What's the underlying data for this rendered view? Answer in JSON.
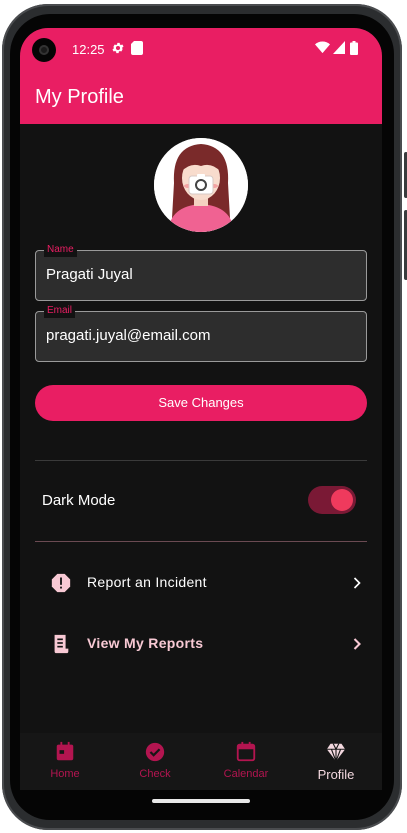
{
  "statusbar": {
    "time": "12:25",
    "icons": [
      "settings-icon",
      "sim-card-icon",
      "wifi-icon",
      "signal-icon",
      "battery-icon"
    ]
  },
  "appbar": {
    "title": "My Profile"
  },
  "profile": {
    "name_label": "Name",
    "name_value": "Pragati Juyal",
    "email_label": "Email",
    "email_value": "pragati.juyal@email.com",
    "save_label": "Save Changes"
  },
  "settings": {
    "dark_mode_label": "Dark Mode",
    "dark_mode_on": true
  },
  "menu": [
    {
      "label": "Report an Incident",
      "icon": "alert-icon"
    },
    {
      "label": "View My Reports",
      "icon": "receipt-icon"
    }
  ],
  "bottom_nav": [
    {
      "label": "Home",
      "icon": "home-icon",
      "active": false
    },
    {
      "label": "Check",
      "icon": "check-circle-icon",
      "active": false
    },
    {
      "label": "Calendar",
      "icon": "calendar-icon",
      "active": false
    },
    {
      "label": "Profile",
      "icon": "diamond-icon",
      "active": true
    }
  ],
  "colors": {
    "accent": "#e91e63",
    "background": "#121212",
    "inactive_nav": "#b31550",
    "menu_text": "#f8c9d4"
  }
}
